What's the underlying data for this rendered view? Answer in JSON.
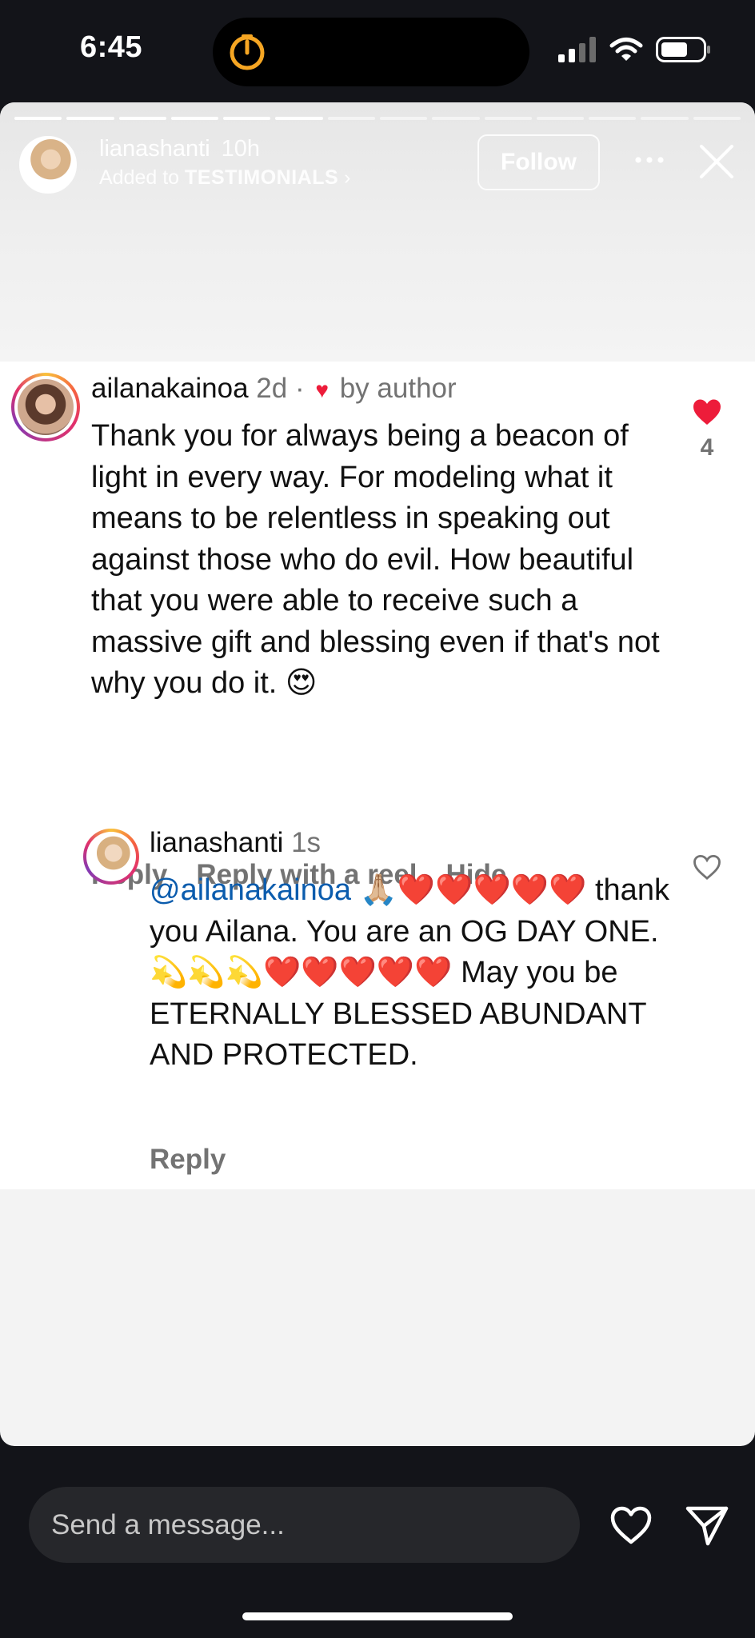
{
  "status_bar": {
    "time": "6:45"
  },
  "story": {
    "progress_segments": 14,
    "progress_completed": 6,
    "username": "lianashanti",
    "age": "10h",
    "added_prefix": "Added to",
    "collection": "TESTIMONIALS",
    "collection_arrow": "›",
    "follow_label": "Follow",
    "icons": {
      "more": "more-dots-icon",
      "close": "close-icon"
    }
  },
  "comments": [
    {
      "username": "ailanakainoa",
      "time": "2d",
      "separator": "·",
      "liked_heart": "♥",
      "liked_by": "by author",
      "text": "Thank you for always being a beacon of light in every way. For modeling what it means to be relentless in speaking out against those who do evil. How beautiful that you were able to receive such a massive gift and blessing even if that's not why you do it. 😍",
      "likes": "4",
      "actions": [
        "Reply",
        "Reply with a reel",
        "Hide"
      ]
    },
    {
      "username": "lianashanti",
      "time": "1s",
      "mention": "@ailanakainoa",
      "text": "🙏🏼❤️❤️❤️❤️❤️ thank you Ailana. You are an OG DAY ONE. 💫💫💫❤️❤️❤️❤️❤️ May you be ETERNALLY BLESSED ABUNDANT AND PROTECTED.",
      "actions": [
        "Reply"
      ]
    }
  ],
  "bottom_bar": {
    "message_placeholder": "Send a message...",
    "icons": {
      "like": "heart-outline-icon",
      "send": "send-icon"
    }
  },
  "colors": {
    "like_red": "#ed1c3a",
    "mention_blue": "#0b5cad",
    "timer_orange": "#f6a623"
  }
}
